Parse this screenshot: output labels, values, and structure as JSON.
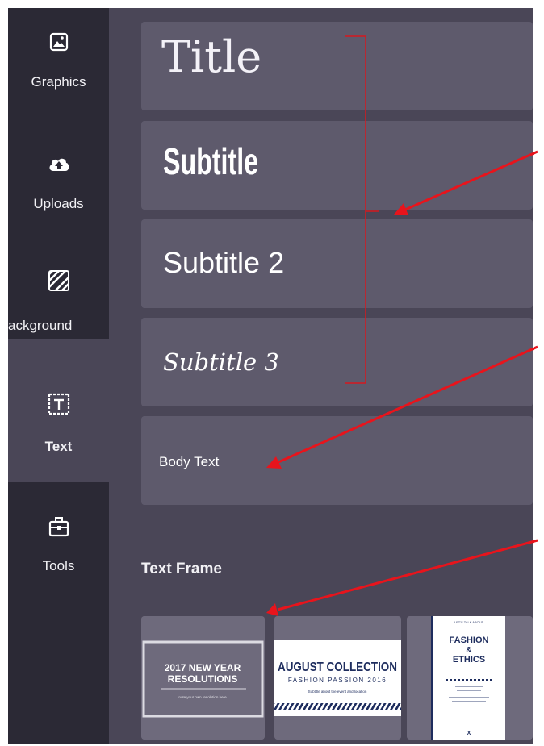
{
  "sidebar": {
    "items": [
      {
        "label": "Graphics",
        "icon": "image-icon"
      },
      {
        "label": "Uploads",
        "icon": "cloud-upload-icon"
      },
      {
        "label": "ackground",
        "icon": "background-pattern-icon"
      },
      {
        "label": "Text",
        "icon": "text-box-icon",
        "active": true
      },
      {
        "label": "Tools",
        "icon": "toolbox-icon"
      }
    ]
  },
  "text_styles": [
    {
      "label": "Title"
    },
    {
      "label": "Subtitle"
    },
    {
      "label": "Subtitle 2"
    },
    {
      "label": "Subtitle 3"
    },
    {
      "label": "Body Text"
    }
  ],
  "text_frame": {
    "section_title": "Text Frame",
    "frames": [
      {
        "line1": "2017 NEW YEAR",
        "line2": "RESOLUTIONS",
        "caption": "note your own resolution here"
      },
      {
        "title": "AUGUST COLLECTION",
        "subtitle": "FASHION PASSION 2016",
        "caption": "Subtitle about the event and location"
      },
      {
        "line1": "FASHION",
        "line2": "&",
        "line3": "ETHICS",
        "top": "LET'S TALK ABOUT",
        "footer": "X"
      }
    ]
  },
  "colors": {
    "sidebar_bg": "#2b2935",
    "panel_bg": "#4a4657",
    "card_bg": "#5e5a6c",
    "annotation": "#e8141c"
  }
}
